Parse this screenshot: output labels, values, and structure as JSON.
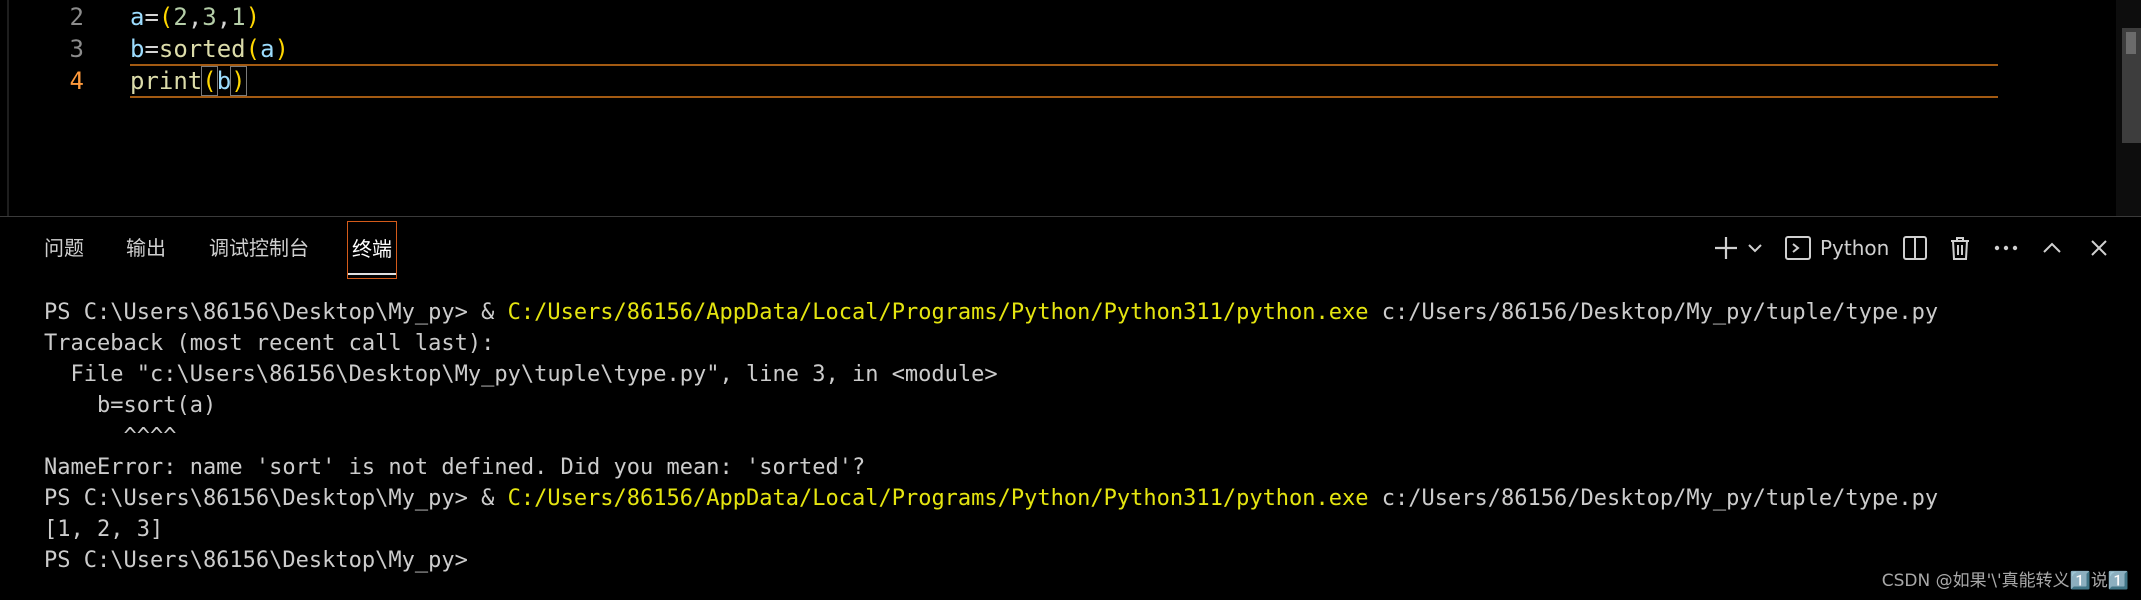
{
  "editor": {
    "lines": [
      {
        "number": "2",
        "active": false,
        "tokens": [
          [
            "var",
            "a"
          ],
          [
            "op",
            "="
          ],
          [
            "br",
            "("
          ],
          [
            "num",
            "2"
          ],
          [
            "op",
            ","
          ],
          [
            "num",
            "3"
          ],
          [
            "op",
            ","
          ],
          [
            "num",
            "1"
          ],
          [
            "br",
            ")"
          ]
        ]
      },
      {
        "number": "3",
        "active": false,
        "tokens": [
          [
            "var",
            "b"
          ],
          [
            "op",
            "="
          ],
          [
            "fn",
            "sorted"
          ],
          [
            "br",
            "("
          ],
          [
            "var",
            "a"
          ],
          [
            "br",
            ")"
          ]
        ]
      },
      {
        "number": "4",
        "active": true,
        "tokens": [
          [
            "fn",
            "print"
          ],
          [
            "brh",
            "("
          ],
          [
            "var",
            "b"
          ],
          [
            "brh",
            ")"
          ]
        ]
      }
    ]
  },
  "panel": {
    "tabs": [
      {
        "id": "problems",
        "label": "问题"
      },
      {
        "id": "output",
        "label": "输出"
      },
      {
        "id": "debug",
        "label": "调试控制台"
      },
      {
        "id": "terminal",
        "label": "终端",
        "active": true
      }
    ],
    "toolbar": {
      "shell_label": "Python"
    }
  },
  "terminal": {
    "lines": [
      [
        [
          "t",
          "PS C:\\Users\\86156\\Desktop\\My_py> & "
        ],
        [
          "p",
          "C:/Users/86156/AppData/Local/Programs/Python/Python311/python.exe"
        ],
        [
          "t",
          " c:/Users/86156/Desktop/My_py/tuple/type.py"
        ]
      ],
      [
        [
          "t",
          "Traceback (most recent call last):"
        ]
      ],
      [
        [
          "t",
          "  File \"c:\\Users\\86156\\Desktop\\My_py\\tuple\\type.py\", line 3, in <module>"
        ]
      ],
      [
        [
          "t",
          "    b=sort(a)"
        ]
      ],
      [
        [
          "t",
          "      ^^^^"
        ]
      ],
      [
        [
          "t",
          "NameError: name 'sort' is not defined. Did you mean: 'sorted'?"
        ]
      ],
      [
        [
          "t",
          "PS C:\\Users\\86156\\Desktop\\My_py> & "
        ],
        [
          "p",
          "C:/Users/86156/AppData/Local/Programs/Python/Python311/python.exe"
        ],
        [
          "t",
          " c:/Users/86156/Desktop/My_py/tuple/type.py"
        ]
      ],
      [
        [
          "t",
          "[1, 2, 3]"
        ]
      ],
      [
        [
          "t",
          "PS C:\\Users\\86156\\Desktop\\My_py> "
        ]
      ]
    ]
  },
  "watermark": "CSDN @如果'\\'真能转义1️⃣说1️⃣",
  "colors": {
    "path": "#e5e510",
    "active_border": "#d45b1a"
  }
}
